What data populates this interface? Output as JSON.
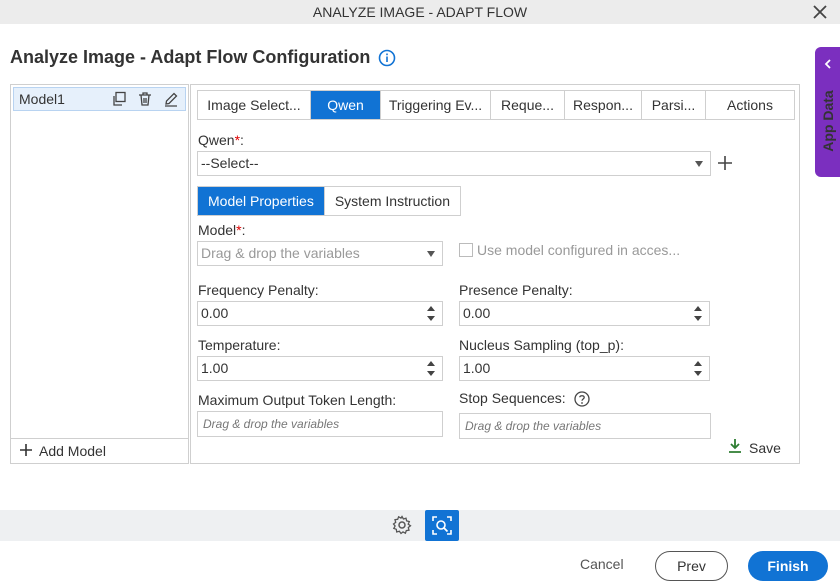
{
  "window": {
    "title": "ANALYZE IMAGE - ADAPT FLOW",
    "close_icon": "close-icon"
  },
  "page": {
    "title": "Analyze Image - Adapt Flow Configuration",
    "info_icon": "info-icon"
  },
  "app_data": {
    "label": "App Data",
    "icon": "chevron-left-icon",
    "color": "#7b2fbf"
  },
  "models": {
    "items": [
      {
        "label": "Model1"
      }
    ],
    "add_label": "Add Model"
  },
  "tabs": [
    {
      "label": "Image Select...",
      "active": false
    },
    {
      "label": "Qwen",
      "active": true
    },
    {
      "label": "Triggering Ev...",
      "active": false
    },
    {
      "label": "Reque...",
      "active": false
    },
    {
      "label": "Respon...",
      "active": false
    },
    {
      "label": "Parsi...",
      "active": false
    },
    {
      "label": "Actions",
      "active": false
    }
  ],
  "qwen": {
    "label": "Qwen",
    "required": "*",
    "colon": ":",
    "value": "--Select--"
  },
  "subtabs": [
    {
      "label": "Model Properties",
      "active": true
    },
    {
      "label": "System Instruction",
      "active": false
    }
  ],
  "model": {
    "label": "Model",
    "required": "*",
    "colon": ":",
    "placeholder": "Drag & drop the variables",
    "checkbox_label": "Use model configured in acces..."
  },
  "frequency_penalty": {
    "label": "Frequency Penalty:",
    "value": "0.00"
  },
  "presence_penalty": {
    "label": "Presence Penalty:",
    "value": "0.00"
  },
  "temperature": {
    "label": "Temperature:",
    "value": "1.00"
  },
  "nucleus_sampling": {
    "label": "Nucleus Sampling (top_p):",
    "value": "1.00"
  },
  "max_output": {
    "label": "Maximum Output Token Length:",
    "placeholder": "Drag & drop the variables"
  },
  "stop_sequences": {
    "label": "Stop Sequences:",
    "placeholder": "Drag & drop the variables"
  },
  "save_label": "Save",
  "footer": {
    "cancel": "Cancel",
    "prev": "Prev",
    "finish": "Finish"
  },
  "colors": {
    "accent": "#1173d4",
    "save_icon": "#2e7d32",
    "required": "#dd0000"
  }
}
